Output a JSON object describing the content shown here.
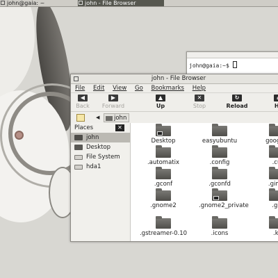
{
  "taskbar": {
    "tasks": [
      {
        "label": "john@gaia: ~"
      },
      {
        "label": "john - File Browser"
      }
    ]
  },
  "terminal": {
    "prompt": "john@gaia:~$"
  },
  "file_browser": {
    "title": "john - File Browser",
    "menu": [
      "File",
      "Edit",
      "View",
      "Go",
      "Bookmarks",
      "Help"
    ],
    "toolbar": [
      {
        "label": "Back",
        "icon": "back-arrow-icon",
        "glyph": "◀",
        "enabled": false
      },
      {
        "label": "Forward",
        "icon": "forward-arrow-icon",
        "glyph": "▶",
        "enabled": false
      },
      {
        "label": "Up",
        "icon": "up-arrow-icon",
        "glyph": "▲",
        "enabled": true
      },
      {
        "label": "Stop",
        "icon": "stop-icon",
        "glyph": "✕",
        "enabled": false
      },
      {
        "label": "Reload",
        "icon": "reload-icon",
        "glyph": "↻",
        "enabled": true
      },
      {
        "label": "Ho",
        "icon": "home-icon",
        "glyph": "⌂",
        "enabled": true
      }
    ],
    "location": {
      "current": "john"
    },
    "sidebar": {
      "title": "Places",
      "close_glyph": "✕",
      "items": [
        {
          "label": "john",
          "icon": "home-folder-icon",
          "selected": true
        },
        {
          "label": "Desktop",
          "icon": "desktop-icon",
          "selected": false
        },
        {
          "label": "File System",
          "icon": "drive-icon",
          "selected": false
        },
        {
          "label": "hda1",
          "icon": "drive-icon",
          "selected": false
        }
      ]
    },
    "files": [
      {
        "name": "Desktop",
        "icon": "desktop-folder-icon",
        "emblem": true
      },
      {
        "name": "easyubuntu",
        "icon": "folder-icon"
      },
      {
        "name": "google-",
        "icon": "folder-icon"
      },
      {
        "name": ".automatix",
        "icon": "folder-icon"
      },
      {
        "name": ".config",
        "icon": "folder-icon"
      },
      {
        "name": ".cu",
        "icon": "folder-icon"
      },
      {
        "name": ".gconf",
        "icon": "folder-icon"
      },
      {
        "name": ".gconfd",
        "icon": "folder-icon"
      },
      {
        "name": ".gimp",
        "icon": "folder-icon"
      },
      {
        "name": ".gnome2",
        "icon": "folder-icon"
      },
      {
        "name": ".gnome2_private",
        "icon": "folder-icon",
        "emblem": true
      },
      {
        "name": ".gn",
        "icon": "folder-icon"
      },
      {
        "name": ".gstreamer-0.10",
        "icon": "folder-icon"
      },
      {
        "name": ".icons",
        "icon": "folder-icon"
      },
      {
        "name": ".ki",
        "icon": "folder-icon"
      }
    ]
  }
}
